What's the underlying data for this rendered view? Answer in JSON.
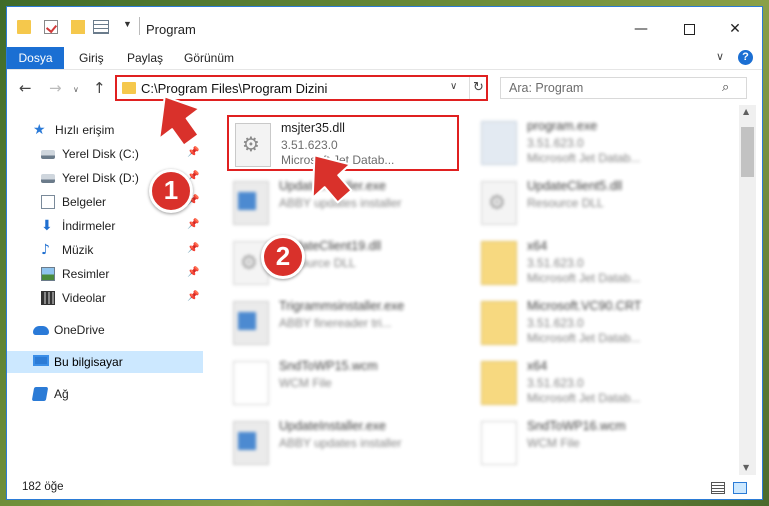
{
  "window": {
    "title": "Program",
    "controls": {
      "minimize": "—",
      "close": "✕"
    }
  },
  "ribbon": {
    "tabs": [
      "Dosya",
      "Giriş",
      "Paylaş",
      "Görünüm"
    ],
    "help": "?"
  },
  "address_bar": {
    "path": "C:\\Program Files\\Program Dizini"
  },
  "search": {
    "placeholder": "Ara: Program"
  },
  "sidebar": {
    "items": [
      {
        "label": "Hızlı erişim",
        "icon": "star-icon",
        "pinned": false
      },
      {
        "label": "Yerel Disk (C:)",
        "icon": "disk-icon",
        "pinned": true
      },
      {
        "label": "Yerel Disk (D:)",
        "icon": "disk-icon",
        "pinned": true
      },
      {
        "label": "Belgeler",
        "icon": "documents-icon",
        "pinned": true
      },
      {
        "label": "İndirmeler",
        "icon": "download-icon",
        "pinned": true
      },
      {
        "label": "Müzik",
        "icon": "music-icon",
        "pinned": true
      },
      {
        "label": "Resimler",
        "icon": "pictures-icon",
        "pinned": true
      },
      {
        "label": "Videolar",
        "icon": "videos-icon",
        "pinned": true
      },
      {
        "label": "OneDrive",
        "icon": "onedrive-icon",
        "pinned": false
      },
      {
        "label": "Bu bilgisayar",
        "icon": "this-pc-icon",
        "pinned": false,
        "selected": true
      },
      {
        "label": "Ağ",
        "icon": "network-icon",
        "pinned": false
      }
    ]
  },
  "files": [
    {
      "name": "msjter35.dll",
      "line1": "3.51.623.0",
      "line2": "Microsoft Jet Datab...",
      "icon": "dll-icon",
      "highlighted": true
    },
    {
      "name": "program.exe",
      "line1": "3.51.623.0",
      "line2": "Microsoft Jet Datab...",
      "icon": "app-icon"
    },
    {
      "name": "UpdateInstaller.exe",
      "line1": "ABBY updates installer",
      "line2": "",
      "icon": "exe-icon"
    },
    {
      "name": "UpdateClient5.dll",
      "line1": "Resource DLL",
      "line2": "",
      "icon": "dll-icon"
    },
    {
      "name": "UpdateClient19.dll",
      "line1": "Resource DLL",
      "line2": "",
      "icon": "dll-icon"
    },
    {
      "name": "x64",
      "line1": "3.51.623.0",
      "line2": "Microsoft Jet Datab...",
      "icon": "folder-icon"
    },
    {
      "name": "Trigrammsinstaller.exe",
      "line1": "ABBY finereader tri...",
      "line2": "",
      "icon": "exe-icon"
    },
    {
      "name": "Microsoft.VC90.CRT",
      "line1": "3.51.623.0",
      "line2": "Microsoft Jet Datab...",
      "icon": "folder-icon"
    },
    {
      "name": "SndToWP15.wcm",
      "line1": "WCM File",
      "line2": "",
      "icon": "file-icon"
    },
    {
      "name": "x64",
      "line1": "3.51.623.0",
      "line2": "Microsoft Jet Datab...",
      "icon": "folder-icon"
    },
    {
      "name": "UpdateInstaller.exe",
      "line1": "ABBY updates installer",
      "line2": "",
      "icon": "exe-icon"
    },
    {
      "name": "SndToWP16.wcm",
      "line1": "WCM File",
      "line2": "",
      "icon": "file-icon"
    }
  ],
  "status": {
    "item_count": "182 öğe"
  },
  "annotations": {
    "step1": "1",
    "step2": "2",
    "color": "#d9312b"
  }
}
